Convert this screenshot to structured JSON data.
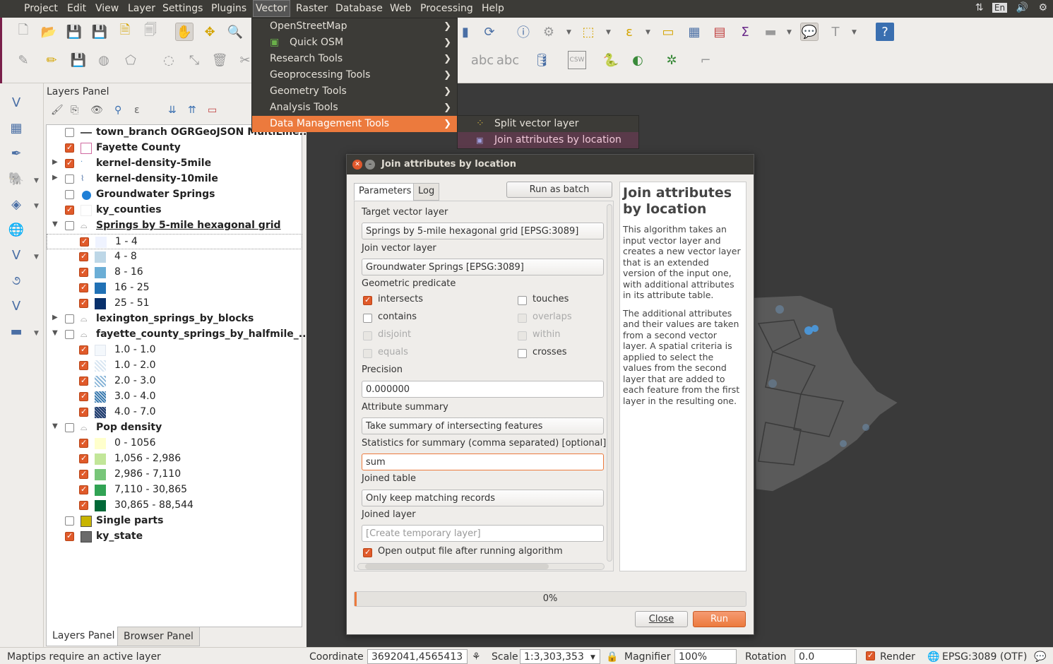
{
  "menubar": {
    "items": [
      "Project",
      "Edit",
      "View",
      "Layer",
      "Settings",
      "Plugins",
      "Vector",
      "Raster",
      "Database",
      "Web",
      "Processing",
      "Help"
    ],
    "open_item": "Vector",
    "tray_lang": "En"
  },
  "vector_menu": {
    "items": [
      "OpenStreetMap",
      "Quick OSM",
      "Research Tools",
      "Geoprocessing Tools",
      "Geometry Tools",
      "Analysis Tools",
      "Data Management Tools"
    ],
    "highlighted": "Data Management Tools"
  },
  "submenu": {
    "items": [
      "Split vector layer",
      "Join attributes by location"
    ],
    "highlighted": "Join attributes by location"
  },
  "layers_panel": {
    "title": "Layers Panel",
    "layers": [
      {
        "label": "town_branch OGRGeoJSON MultiLine...",
        "checked": false,
        "bold": true
      },
      {
        "label": "Fayette County",
        "checked": true,
        "bold": true
      },
      {
        "label": "kernel-density-5mile",
        "checked": true,
        "bold": true
      },
      {
        "label": "kernel-density-10mile",
        "checked": false,
        "bold": true
      },
      {
        "label": "Groundwater Springs",
        "checked": false,
        "bold": true
      },
      {
        "label": "ky_counties",
        "checked": true,
        "bold": true
      },
      {
        "label": "Springs by 5-mile hexagonal grid",
        "checked": false,
        "bold": true
      },
      {
        "label": "1 - 4",
        "checked": true
      },
      {
        "label": "4 - 8",
        "checked": true
      },
      {
        "label": "8 - 16",
        "checked": true
      },
      {
        "label": "16 - 25",
        "checked": true
      },
      {
        "label": "25 - 51",
        "checked": true
      },
      {
        "label": "lexington_springs_by_blocks",
        "checked": false,
        "bold": true
      },
      {
        "label": "fayette_county_springs_by_halfmile_...",
        "checked": false,
        "bold": true
      },
      {
        "label": "1.0 - 1.0",
        "checked": true
      },
      {
        "label": "1.0 - 2.0",
        "checked": true
      },
      {
        "label": "2.0 - 3.0",
        "checked": true
      },
      {
        "label": "3.0 - 4.0",
        "checked": true
      },
      {
        "label": "4.0 - 7.0",
        "checked": true
      },
      {
        "label": "Pop density",
        "checked": false,
        "bold": true
      },
      {
        "label": "0 - 1056",
        "checked": true
      },
      {
        "label": "1,056 - 2,986",
        "checked": true
      },
      {
        "label": "2,986 - 7,110",
        "checked": true
      },
      {
        "label": "7,110 - 30,865",
        "checked": true
      },
      {
        "label": "30,865 - 88,544",
        "checked": true
      },
      {
        "label": "Single parts",
        "checked": false,
        "bold": true
      },
      {
        "label": "ky_state",
        "checked": true,
        "bold": true
      }
    ],
    "tabs": [
      "Layers Panel",
      "Browser Panel"
    ]
  },
  "dialog": {
    "title": "Join attributes by location",
    "tabs": [
      "Parameters",
      "Log"
    ],
    "batch_button": "Run as batch process...",
    "target_label": "Target vector layer",
    "target_value": "Springs by 5-mile hexagonal grid [EPSG:3089]",
    "join_label": "Join vector layer",
    "join_value": "Groundwater Springs [EPSG:3089]",
    "predicate_label": "Geometric predicate",
    "predicates": {
      "intersects": "intersects",
      "touches": "touches",
      "contains": "contains",
      "overlaps": "overlaps",
      "disjoint": "disjoint",
      "within": "within",
      "equals": "equals",
      "crosses": "crosses"
    },
    "precision_label": "Precision",
    "precision_value": "0.000000",
    "summary_label": "Attribute summary",
    "summary_value": "Take summary of intersecting features",
    "stats_label": "Statistics for summary (comma separated) [optional]",
    "stats_value": "sum",
    "joined_table_label": "Joined table",
    "joined_table_value": "Only keep matching records",
    "joined_layer_label": "Joined layer",
    "joined_layer_placeholder": "[Create temporary layer]",
    "open_output_label": "Open output file after running algorithm",
    "help_title": "Join attributes by location",
    "help_p1": "This algorithm takes an input vector layer and creates a new vector layer that is an extended version of the input one, with additional attributes in its attribute table.",
    "help_p2": "The additional attributes and their values are taken from a second vector layer. A spatial criteria is applied to select the values from the second layer that are added to each feature from the first layer in the resulting one.",
    "progress_text": "0%",
    "progress": 0,
    "close_label": "Close",
    "run_label": "Run"
  },
  "statusbar": {
    "message": "Maptips require an active layer",
    "coordinate_label": "Coordinate",
    "coordinate_value": "3692041,4565413",
    "scale_label": "Scale",
    "scale_value": "1:3,303,353",
    "magnifier_label": "Magnifier",
    "magnifier_value": "100%",
    "rotation_label": "Rotation",
    "rotation_value": "0.0",
    "render_label": "Render",
    "crs": "EPSG:3089 (OTF)"
  },
  "colors": {
    "accent": "#ec7a3d",
    "menubar": "#3c3b37",
    "hex_ramp": [
      "#eff3ff",
      "#bdd7e7",
      "#6baed6",
      "#2171b5",
      "#08306b"
    ],
    "pop_ramp": [
      "#ffffcc",
      "#c2e699",
      "#78c679",
      "#31a354",
      "#006837"
    ]
  }
}
